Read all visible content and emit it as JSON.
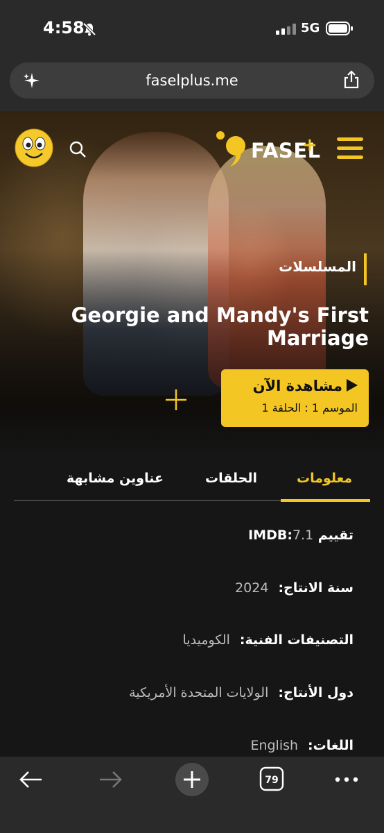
{
  "status_bar": {
    "time": "4:58",
    "network": "5G"
  },
  "browser": {
    "url": "faselplus.me",
    "tab_count": "79"
  },
  "site": {
    "logo_text": "FASEL",
    "logo_plus": "+",
    "accent_color": "#f3c623"
  },
  "hero": {
    "category": "المسلسلات",
    "title": "Georgie and Mandy's First Marriage",
    "watch_label": "مشاهدة الآن",
    "watch_sub": "الموسم 1 : الحلقة 1"
  },
  "tabs": [
    {
      "label": "معلومات",
      "active": true
    },
    {
      "label": "الحلقات",
      "active": false
    },
    {
      "label": "عناوين مشابهة",
      "active": false
    }
  ],
  "info": [
    {
      "key": "تقييم IMDB:",
      "value": "7.1"
    },
    {
      "key": "سنة الانتاج:",
      "value": "2024"
    },
    {
      "key": "التصنيفات الفنية:",
      "value": "الكوميديا"
    },
    {
      "key": "دول الأنتاج:",
      "value": "الولايات المتحدة الأمريكية"
    },
    {
      "key": "اللغات:",
      "value": "English"
    }
  ]
}
